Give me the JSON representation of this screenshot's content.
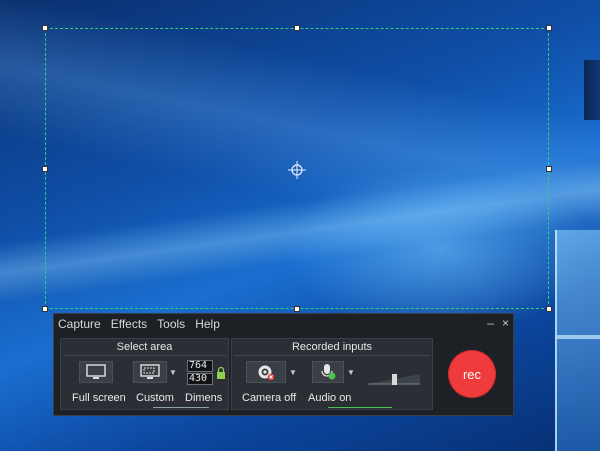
{
  "menu": {
    "items": [
      "Capture",
      "Effects",
      "Tools",
      "Help"
    ],
    "minimize": "–",
    "close": "×"
  },
  "select_area": {
    "title": "Select area",
    "full_screen_label": "Full screen",
    "custom_label": "Custom",
    "dimensions_label": "Dimens",
    "width": "764",
    "height": "430"
  },
  "recorded_inputs": {
    "title": "Recorded inputs",
    "camera_label": "Camera off",
    "audio_label": "Audio on"
  },
  "rec_button": {
    "label": "rec"
  },
  "colors": {
    "accent_green": "#2fd07c",
    "rec_red": "#ef3b3b",
    "panel_bg": "#2b2f35",
    "toolbar_bg": "#1d2024"
  },
  "icons": {
    "monitor": "monitor-icon",
    "custom_area": "custom-area-icon",
    "camera": "camera-off-icon",
    "microphone": "microphone-icon",
    "lock": "lock-icon",
    "crosshair": "crosshair-icon"
  }
}
